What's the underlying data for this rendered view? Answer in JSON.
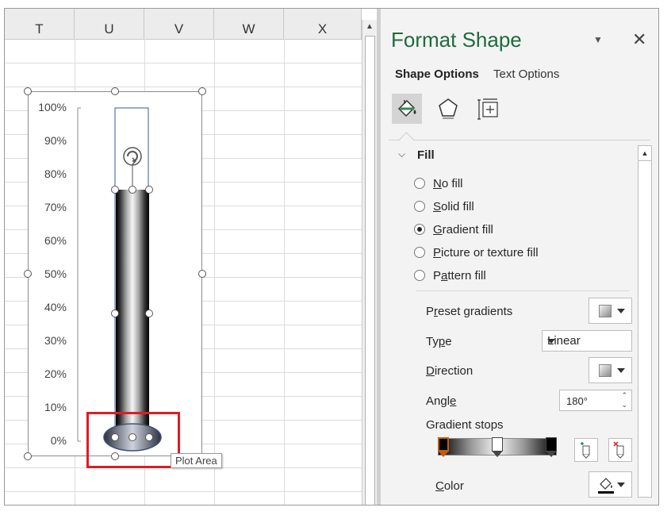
{
  "sheet": {
    "columns": [
      "T",
      "U",
      "V",
      "W",
      "X"
    ]
  },
  "chart": {
    "y_ticks": [
      "100%",
      "90%",
      "80%",
      "70%",
      "60%",
      "50%",
      "40%",
      "30%",
      "20%",
      "10%",
      "0%"
    ],
    "tooltip": "Plot Area",
    "highlight_color": "#e01b22"
  },
  "pane": {
    "title": "Format Shape",
    "title_color": "#1e6b3e",
    "close_symbol": "✕",
    "tabs": {
      "shape_options": "Shape Options",
      "text_options": "Text Options"
    },
    "icons": [
      "fill-line-icon",
      "effects-pentagon-icon",
      "size-properties-icon"
    ],
    "fill": {
      "heading": "Fill",
      "options": [
        {
          "pre": "",
          "key": "N",
          "post": "o fill",
          "selected": false
        },
        {
          "pre": "",
          "key": "S",
          "post": "olid fill",
          "selected": false
        },
        {
          "pre": "",
          "key": "G",
          "post": "radient fill",
          "selected": true
        },
        {
          "pre": "",
          "key": "P",
          "post": "icture or texture fill",
          "selected": false
        },
        {
          "pre": "P",
          "key": "a",
          "post": "ttern fill",
          "selected": false
        }
      ]
    },
    "props": {
      "preset_gradients": {
        "pre": "P",
        "key": "r",
        "post": "eset gradients"
      },
      "type": {
        "pre": "Ty",
        "key": "p",
        "post": "e",
        "value": "Linear"
      },
      "direction": {
        "pre": "",
        "key": "D",
        "post": "irection"
      },
      "angle": {
        "pre": "Angl",
        "key": "e",
        "post": "",
        "value": "180°"
      },
      "gradient_stops": "Gradient stops",
      "color": {
        "pre": "",
        "key": "C",
        "post": "olor"
      }
    },
    "gradient_stop_positions": [
      0,
      0.5,
      1
    ]
  }
}
